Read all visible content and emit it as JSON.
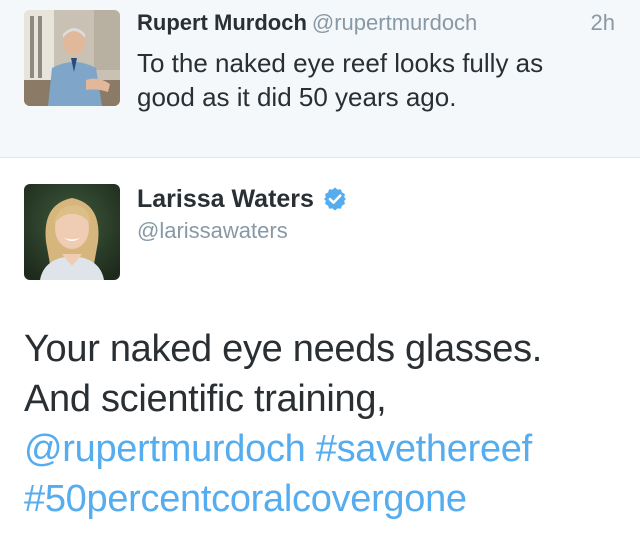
{
  "colors": {
    "text_primary": "#292f33",
    "text_secondary": "#8899a6",
    "link": "#55acee",
    "top_background": "#f5f8fa",
    "divider": "#e1e8ed",
    "verified": "#55acee"
  },
  "reply_to_tweet": {
    "author_name": "Rupert Murdoch",
    "author_handle": "@rupertmurdoch",
    "timestamp": "2h",
    "text_line1": "To the naked eye reef looks fully as",
    "text_line2": "good as it did 50 years ago.",
    "avatar_icon": "user-photo-avatar"
  },
  "main_tweet": {
    "author_name": "Larissa Waters",
    "author_handle": "@larissawaters",
    "verified_icon": "verified-badge-icon",
    "avatar_icon": "user-photo-avatar",
    "text_line1": "Your naked eye needs glasses.",
    "text_line2": "And scientific training,",
    "mention": "@rupertmurdoch",
    "hashtag1": "#savethereef",
    "hashtag2": "#50percentcoralcovergone"
  }
}
